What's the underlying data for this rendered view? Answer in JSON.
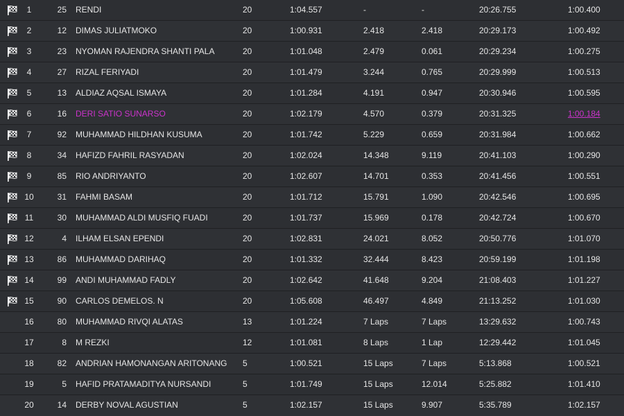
{
  "colors": {
    "background": "#2b2d31",
    "text": "#e6e6e6",
    "highlight": "#cc33cc",
    "flag": "#ffffff"
  },
  "icons": {
    "finished": "checkered-flag-icon"
  },
  "rows": [
    {
      "finished": true,
      "pos": "1",
      "number": "25",
      "name": "RENDI",
      "laps": "20",
      "best_lap": "1:04.557",
      "gap": "-",
      "interval": "-",
      "total_time": "20:26.755",
      "fastest_lap": "1:00.400",
      "highlight": false
    },
    {
      "finished": true,
      "pos": "2",
      "number": "12",
      "name": "DIMAS JULIATMOKO",
      "laps": "20",
      "best_lap": "1:00.931",
      "gap": "2.418",
      "interval": "2.418",
      "total_time": "20:29.173",
      "fastest_lap": "1:00.492",
      "highlight": false
    },
    {
      "finished": true,
      "pos": "3",
      "number": "23",
      "name": "NYOMAN RAJENDRA SHANTI PALA",
      "laps": "20",
      "best_lap": "1:01.048",
      "gap": "2.479",
      "interval": "0.061",
      "total_time": "20:29.234",
      "fastest_lap": "1:00.275",
      "highlight": false
    },
    {
      "finished": true,
      "pos": "4",
      "number": "27",
      "name": "RIZAL FERIYADI",
      "laps": "20",
      "best_lap": "1:01.479",
      "gap": "3.244",
      "interval": "0.765",
      "total_time": "20:29.999",
      "fastest_lap": "1:00.513",
      "highlight": false
    },
    {
      "finished": true,
      "pos": "5",
      "number": "13",
      "name": "ALDIAZ AQSAL ISMAYA",
      "laps": "20",
      "best_lap": "1:01.284",
      "gap": "4.191",
      "interval": "0.947",
      "total_time": "20:30.946",
      "fastest_lap": "1:00.595",
      "highlight": false
    },
    {
      "finished": true,
      "pos": "6",
      "number": "16",
      "name": "DERI SATIO SUNARSO",
      "laps": "20",
      "best_lap": "1:02.179",
      "gap": "4.570",
      "interval": "0.379",
      "total_time": "20:31.325",
      "fastest_lap": "1:00.184",
      "highlight": true
    },
    {
      "finished": true,
      "pos": "7",
      "number": "92",
      "name": "MUHAMMAD HILDHAN KUSUMA",
      "laps": "20",
      "best_lap": "1:01.742",
      "gap": "5.229",
      "interval": "0.659",
      "total_time": "20:31.984",
      "fastest_lap": "1:00.662",
      "highlight": false
    },
    {
      "finished": true,
      "pos": "8",
      "number": "34",
      "name": "HAFIZD FAHRIL RASYADAN",
      "laps": "20",
      "best_lap": "1:02.024",
      "gap": "14.348",
      "interval": "9.119",
      "total_time": "20:41.103",
      "fastest_lap": "1:00.290",
      "highlight": false
    },
    {
      "finished": true,
      "pos": "9",
      "number": "85",
      "name": "RIO ANDRIYANTO",
      "laps": "20",
      "best_lap": "1:02.607",
      "gap": "14.701",
      "interval": "0.353",
      "total_time": "20:41.456",
      "fastest_lap": "1:00.551",
      "highlight": false
    },
    {
      "finished": true,
      "pos": "10",
      "number": "31",
      "name": "FAHMI BASAM",
      "laps": "20",
      "best_lap": "1:01.712",
      "gap": "15.791",
      "interval": "1.090",
      "total_time": "20:42.546",
      "fastest_lap": "1:00.695",
      "highlight": false
    },
    {
      "finished": true,
      "pos": "11",
      "number": "30",
      "name": "MUHAMMAD ALDI MUSFIQ FUADI",
      "laps": "20",
      "best_lap": "1:01.737",
      "gap": "15.969",
      "interval": "0.178",
      "total_time": "20:42.724",
      "fastest_lap": "1:00.670",
      "highlight": false
    },
    {
      "finished": true,
      "pos": "12",
      "number": "4",
      "name": "ILHAM ELSAN EPENDI",
      "laps": "20",
      "best_lap": "1:02.831",
      "gap": "24.021",
      "interval": "8.052",
      "total_time": "20:50.776",
      "fastest_lap": "1:01.070",
      "highlight": false
    },
    {
      "finished": true,
      "pos": "13",
      "number": "86",
      "name": "MUHAMMAD DARIHAQ",
      "laps": "20",
      "best_lap": "1:01.332",
      "gap": "32.444",
      "interval": "8.423",
      "total_time": "20:59.199",
      "fastest_lap": "1:01.198",
      "highlight": false
    },
    {
      "finished": true,
      "pos": "14",
      "number": "99",
      "name": "ANDI MUHAMMAD FADLY",
      "laps": "20",
      "best_lap": "1:02.642",
      "gap": "41.648",
      "interval": "9.204",
      "total_time": "21:08.403",
      "fastest_lap": "1:01.227",
      "highlight": false
    },
    {
      "finished": true,
      "pos": "15",
      "number": "90",
      "name": "CARLOS DEMELOS. N",
      "laps": "20",
      "best_lap": "1:05.608",
      "gap": "46.497",
      "interval": "4.849",
      "total_time": "21:13.252",
      "fastest_lap": "1:01.030",
      "highlight": false
    },
    {
      "finished": false,
      "pos": "16",
      "number": "80",
      "name": "MUHAMMAD RIVQI ALATAS",
      "laps": "13",
      "best_lap": "1:01.224",
      "gap": "7 Laps",
      "interval": "7 Laps",
      "total_time": "13:29.632",
      "fastest_lap": "1:00.743",
      "highlight": false
    },
    {
      "finished": false,
      "pos": "17",
      "number": "8",
      "name": "M REZKI",
      "laps": "12",
      "best_lap": "1:01.081",
      "gap": "8 Laps",
      "interval": "1 Lap",
      "total_time": "12:29.442",
      "fastest_lap": "1:01.045",
      "highlight": false
    },
    {
      "finished": false,
      "pos": "18",
      "number": "82",
      "name": "ANDRIAN HAMONANGAN ARITONANG",
      "laps": "5",
      "best_lap": "1:00.521",
      "gap": "15 Laps",
      "interval": "7 Laps",
      "total_time": "5:13.868",
      "fastest_lap": "1:00.521",
      "highlight": false
    },
    {
      "finished": false,
      "pos": "19",
      "number": "5",
      "name": "HAFID PRATAMADITYA NURSANDI",
      "laps": "5",
      "best_lap": "1:01.749",
      "gap": "15 Laps",
      "interval": "12.014",
      "total_time": "5:25.882",
      "fastest_lap": "1:01.410",
      "highlight": false
    },
    {
      "finished": false,
      "pos": "20",
      "number": "14",
      "name": "DERBY NOVAL AGUSTIAN",
      "laps": "5",
      "best_lap": "1:02.157",
      "gap": "15 Laps",
      "interval": "9.907",
      "total_time": "5:35.789",
      "fastest_lap": "1:02.157",
      "highlight": false
    }
  ]
}
